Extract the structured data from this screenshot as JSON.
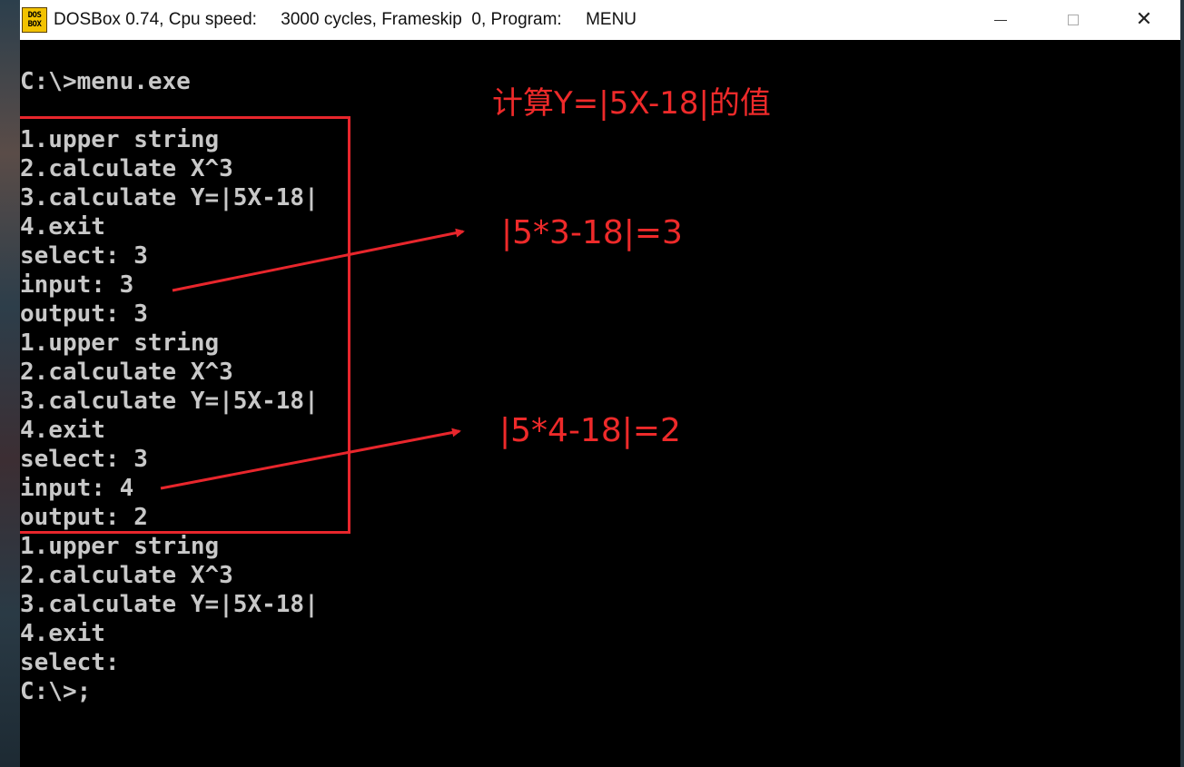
{
  "window": {
    "icon_lines": [
      "DOS",
      "BOX"
    ],
    "title": "DOSBox 0.74, Cpu speed:     3000 cycles, Frameskip  0, Program:     MENU",
    "buttons": {
      "minimize": "minimize",
      "maximize": "maximize",
      "close": "✕"
    }
  },
  "terminal": {
    "lines": [
      "C:\\>menu.exe",
      "",
      "1.upper string",
      "2.calculate X^3",
      "3.calculate Y=|5X-18|",
      "4.exit",
      "select: 3",
      "input: 3",
      "output: 3",
      "1.upper string",
      "2.calculate X^3",
      "3.calculate Y=|5X-18|",
      "4.exit",
      "select: 3",
      "input: 4",
      "output: 2",
      "1.upper string",
      "2.calculate X^3",
      "3.calculate Y=|5X-18|",
      "4.exit",
      "select:",
      "C:\\>;"
    ]
  },
  "annotations": {
    "title": "计算Y=|5X-18|的值",
    "equation_1": "|5*3-18|=3",
    "equation_2": "|5*4-18|=2",
    "color": "#ee2a2a"
  },
  "colors": {
    "terminal_bg": "#000000",
    "terminal_text": "#c8c8c8",
    "titlebar_bg": "#ffffff",
    "annotation_red": "#e8262c"
  }
}
